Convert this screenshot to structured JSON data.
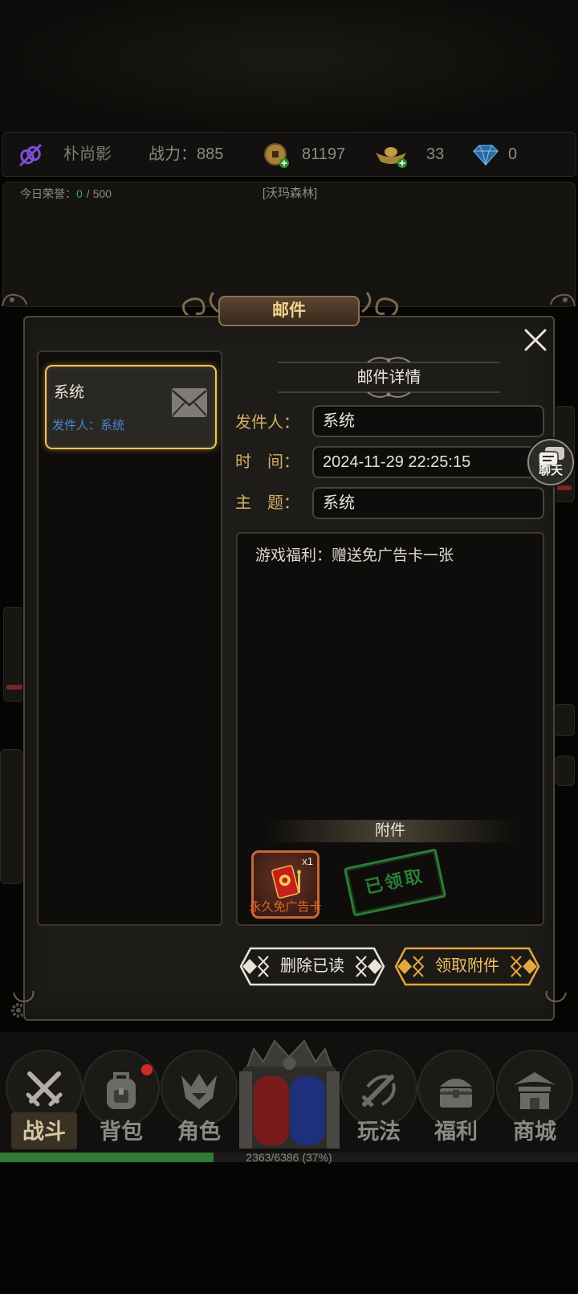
{
  "top_bar": {
    "guild_icon": "no-guild-icon",
    "player_name": "朴尚影",
    "power_label": "战力：",
    "power_value": "885",
    "coin_icon": "coin-add-icon",
    "coins": "81197",
    "ingot_icon": "gold-ingot-add-icon",
    "ingots": "33",
    "diamond_icon": "diamond-icon",
    "diamonds": "0"
  },
  "honor": {
    "label": "今日荣誉：",
    "current": "0",
    "max_text": "/ 500"
  },
  "location": "[沃玛森林]",
  "mail_dialog": {
    "title": "邮件",
    "close_icon": "close-icon",
    "mail_list": [
      {
        "title": "系统",
        "sender_line": "发件人：系统",
        "icon": "envelope-icon",
        "selected": true
      }
    ],
    "detail": {
      "header": "邮件详情",
      "sender_label": "发件人：",
      "sender_value": "系统",
      "time_label": "时　间：",
      "time_value": "2024-11-29 22:25:15",
      "subject_label": "主　题：",
      "subject_value": "系统",
      "body": "游戏福利：赠送免广告卡一张"
    },
    "attachments": {
      "header": "附件",
      "items": [
        {
          "name": "永久免广告卡",
          "count": "x1",
          "icon": "red-card-icon"
        }
      ],
      "claimed_stamp": "已领取"
    },
    "buttons": {
      "delete_read": "删除已读",
      "claim": "领取附件"
    }
  },
  "chat_button": {
    "label": "聊天",
    "icon": "chat-bubbles-icon"
  },
  "bottom_nav": [
    {
      "label": "战斗",
      "icon": "crossed-swords-icon",
      "active": true
    },
    {
      "label": "背包",
      "icon": "backpack-icon",
      "badge": true
    },
    {
      "label": "角色",
      "icon": "character-helmet-icon"
    },
    {
      "label": "玩法",
      "icon": "sword-swirl-icon"
    },
    {
      "label": "福利",
      "icon": "treasure-chest-icon"
    },
    {
      "label": "商城",
      "icon": "shop-pagoda-icon"
    }
  ],
  "center_button": {
    "icon": "portal-gate-icon"
  },
  "progress": {
    "current": 2363,
    "max": 6386,
    "percent": 37,
    "text": "2363/6386 (37%)"
  },
  "colors": {
    "accent_gold": "#f2c45a",
    "label_gold": "#d8ae64",
    "sender_blue": "#4a84d4",
    "honor_green": "#3fae3f",
    "claimed_green": "#2f8a3b",
    "attachment_border": "#c9663a",
    "progress_green": "#2f7a36",
    "badge_red": "#d12a2a"
  }
}
